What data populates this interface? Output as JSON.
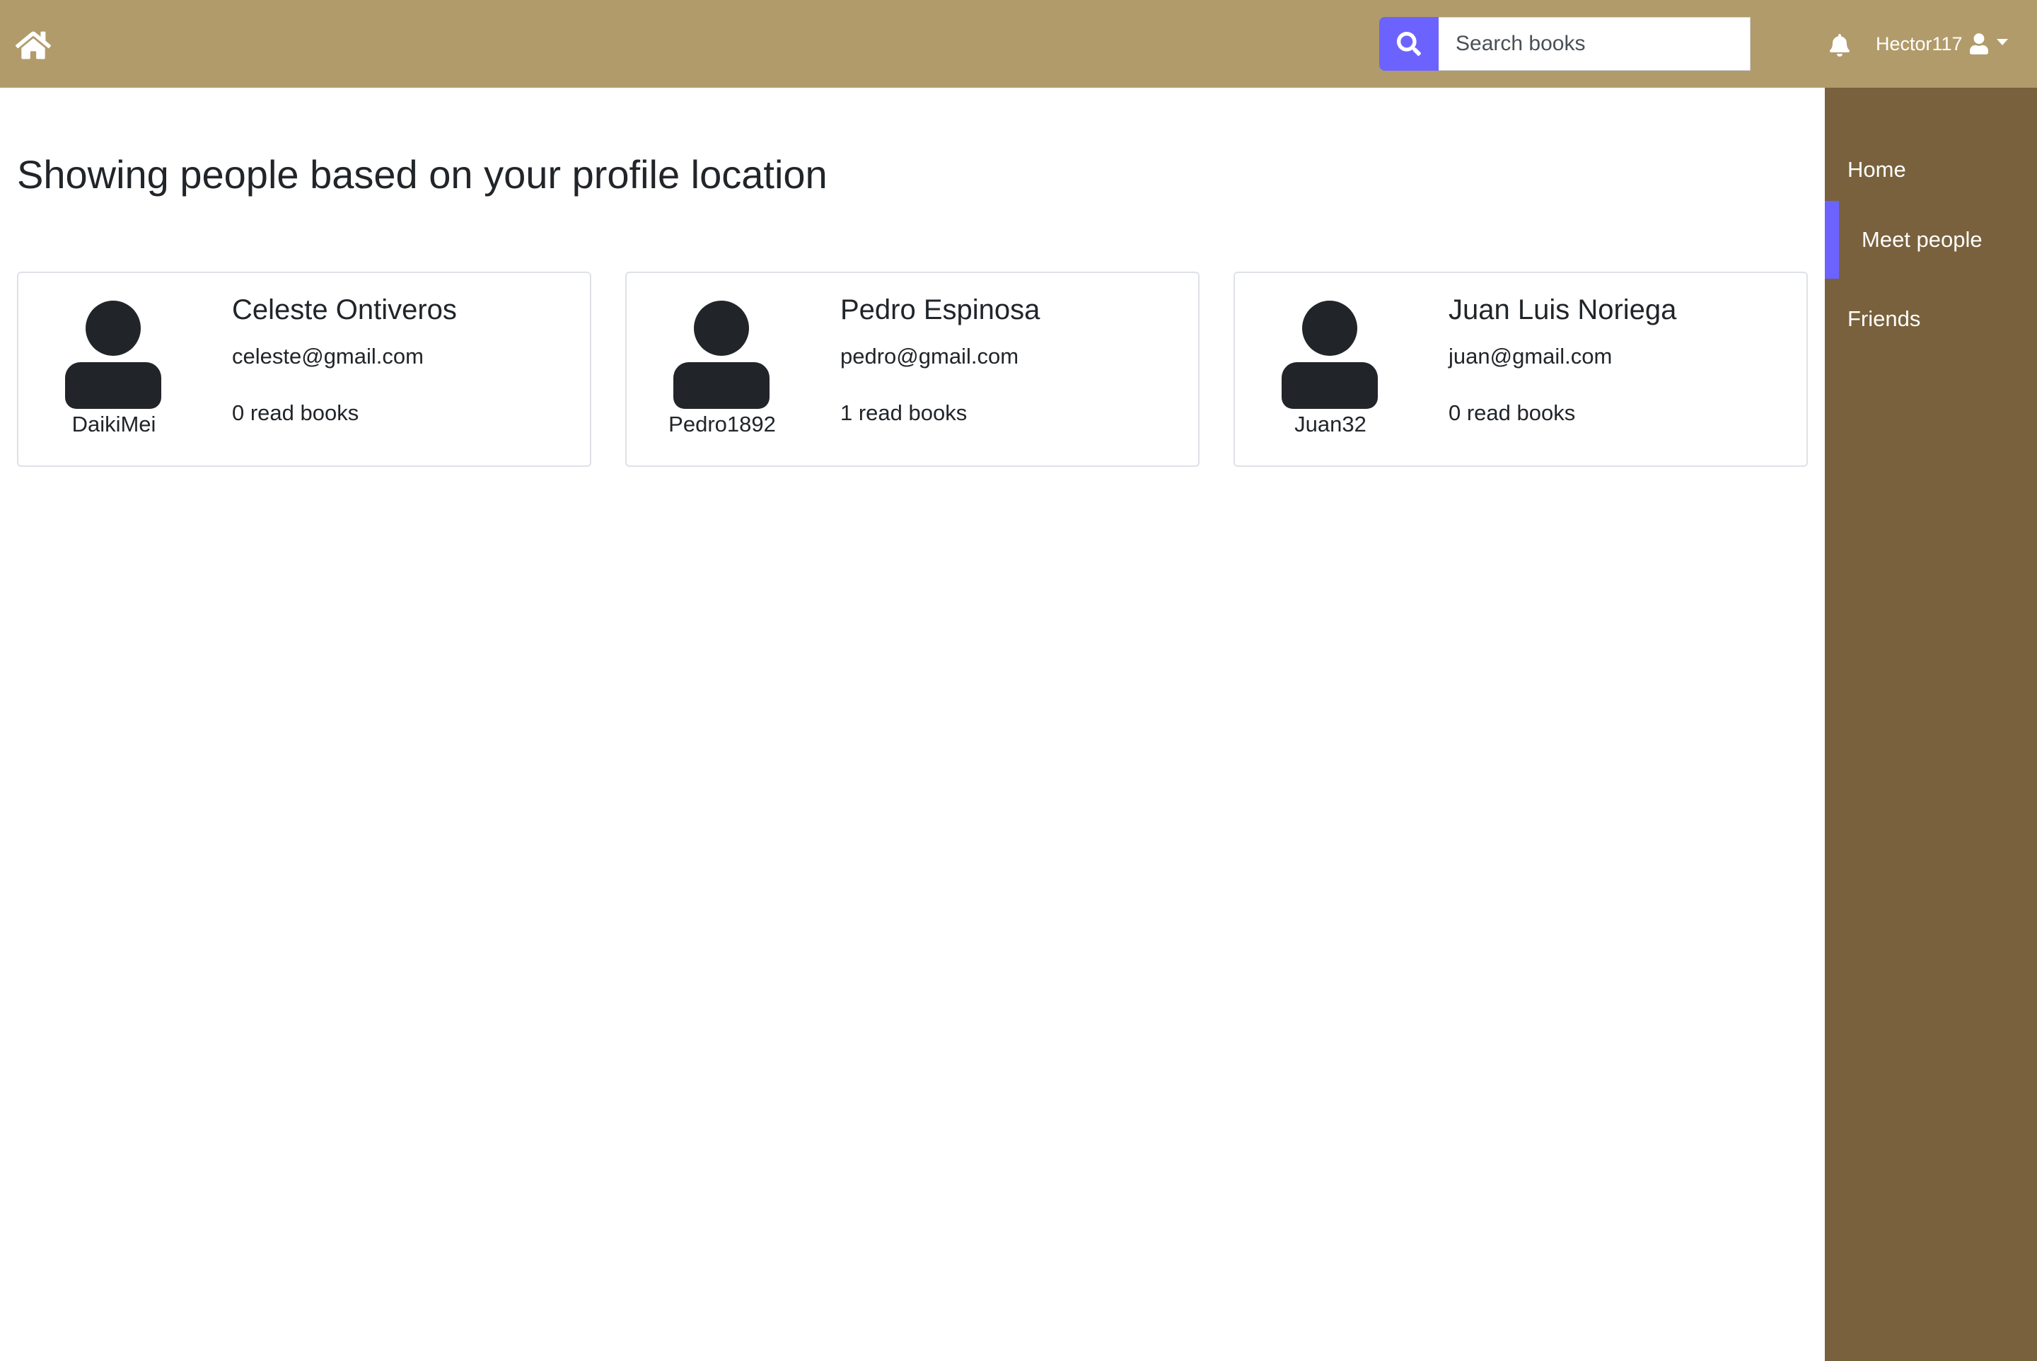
{
  "navbar": {
    "search": {
      "placeholder": "Search books",
      "value": ""
    },
    "user": {
      "username": "Hector117"
    }
  },
  "sidebar": {
    "items": [
      {
        "label": "Home",
        "active": false
      },
      {
        "label": "Meet people",
        "active": true
      },
      {
        "label": "Friends",
        "active": false
      }
    ]
  },
  "main": {
    "title": "Showing people based on your profile location",
    "people": [
      {
        "name": "Celeste Ontiveros",
        "email": "celeste@gmail.com",
        "read_books": "0 read books",
        "username": "DaikiMei"
      },
      {
        "name": "Pedro Espinosa",
        "email": "pedro@gmail.com",
        "read_books": "1 read books",
        "username": "Pedro1892"
      },
      {
        "name": "Juan Luis Noriega",
        "email": "juan@gmail.com",
        "read_books": "0 read books",
        "username": "Juan32"
      }
    ]
  },
  "colors": {
    "navbar_bg": "#b19b6a",
    "sidebar_bg": "#78613c",
    "accent": "#6c63ff",
    "text": "#212529",
    "card_border": "#dee2e6"
  },
  "icons": {
    "home": "home-icon",
    "search": "search-icon",
    "bell": "bell-icon",
    "user": "user-icon",
    "avatar": "user-avatar-icon"
  }
}
